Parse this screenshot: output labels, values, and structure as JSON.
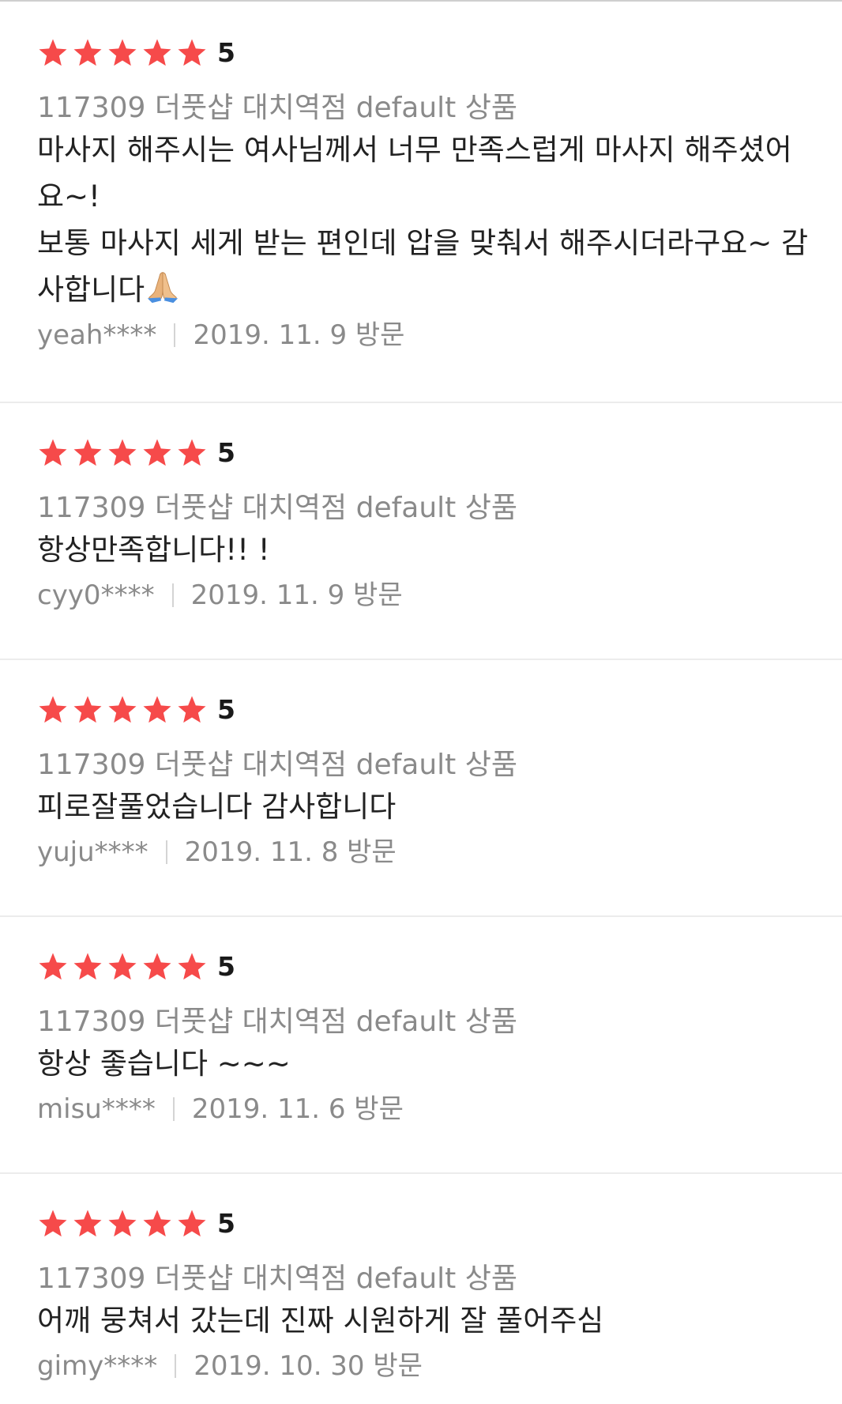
{
  "reviews": [
    {
      "score": "5",
      "stars": 5,
      "product": "117309 더풋샵 대치역점 default 상품",
      "lines": [
        "마사지 해주시는 여사님께서 너무 만족스럽게 마사지 해주셨어",
        "요~!",
        "보통 마사지 세게 받는 편인데 압을 맞춰서 해주시더라구요~ 감",
        "사합니다"
      ],
      "user": "yeah****",
      "visit": "2019. 11. 9 방문"
    },
    {
      "score": "5",
      "stars": 5,
      "product": "117309 더풋샵 대치역점 default 상품",
      "lines": [
        "항상만족합니다!! !"
      ],
      "user": "cyy0****",
      "visit": "2019. 11. 9 방문"
    },
    {
      "score": "5",
      "stars": 5,
      "product": "117309 더풋샵 대치역점 default 상품",
      "lines": [
        "피로잘풀었습니다 감사합니다"
      ],
      "user": "yuju****",
      "visit": "2019. 11. 8 방문"
    },
    {
      "score": "5",
      "stars": 5,
      "product": "117309 더풋샵 대치역점 default 상품",
      "lines": [
        "항상 좋습니다 ~~~"
      ],
      "user": "misu****",
      "visit": "2019. 11. 6 방문"
    },
    {
      "score": "5",
      "stars": 5,
      "product": "117309 더풋샵 대치역점 default 상품",
      "lines": [
        "어깨 뭉쳐서 갔는데 진짜 시원하게 잘 풀어주심"
      ],
      "user": "gimy****",
      "visit": "2019. 10. 30 방문"
    }
  ],
  "colors": {
    "star": "#f64a4a",
    "muted_text": "#8a8a8a",
    "body_text": "#222222"
  },
  "icons": {
    "star": "star-icon",
    "emoji": "folded-hands-emoji"
  }
}
